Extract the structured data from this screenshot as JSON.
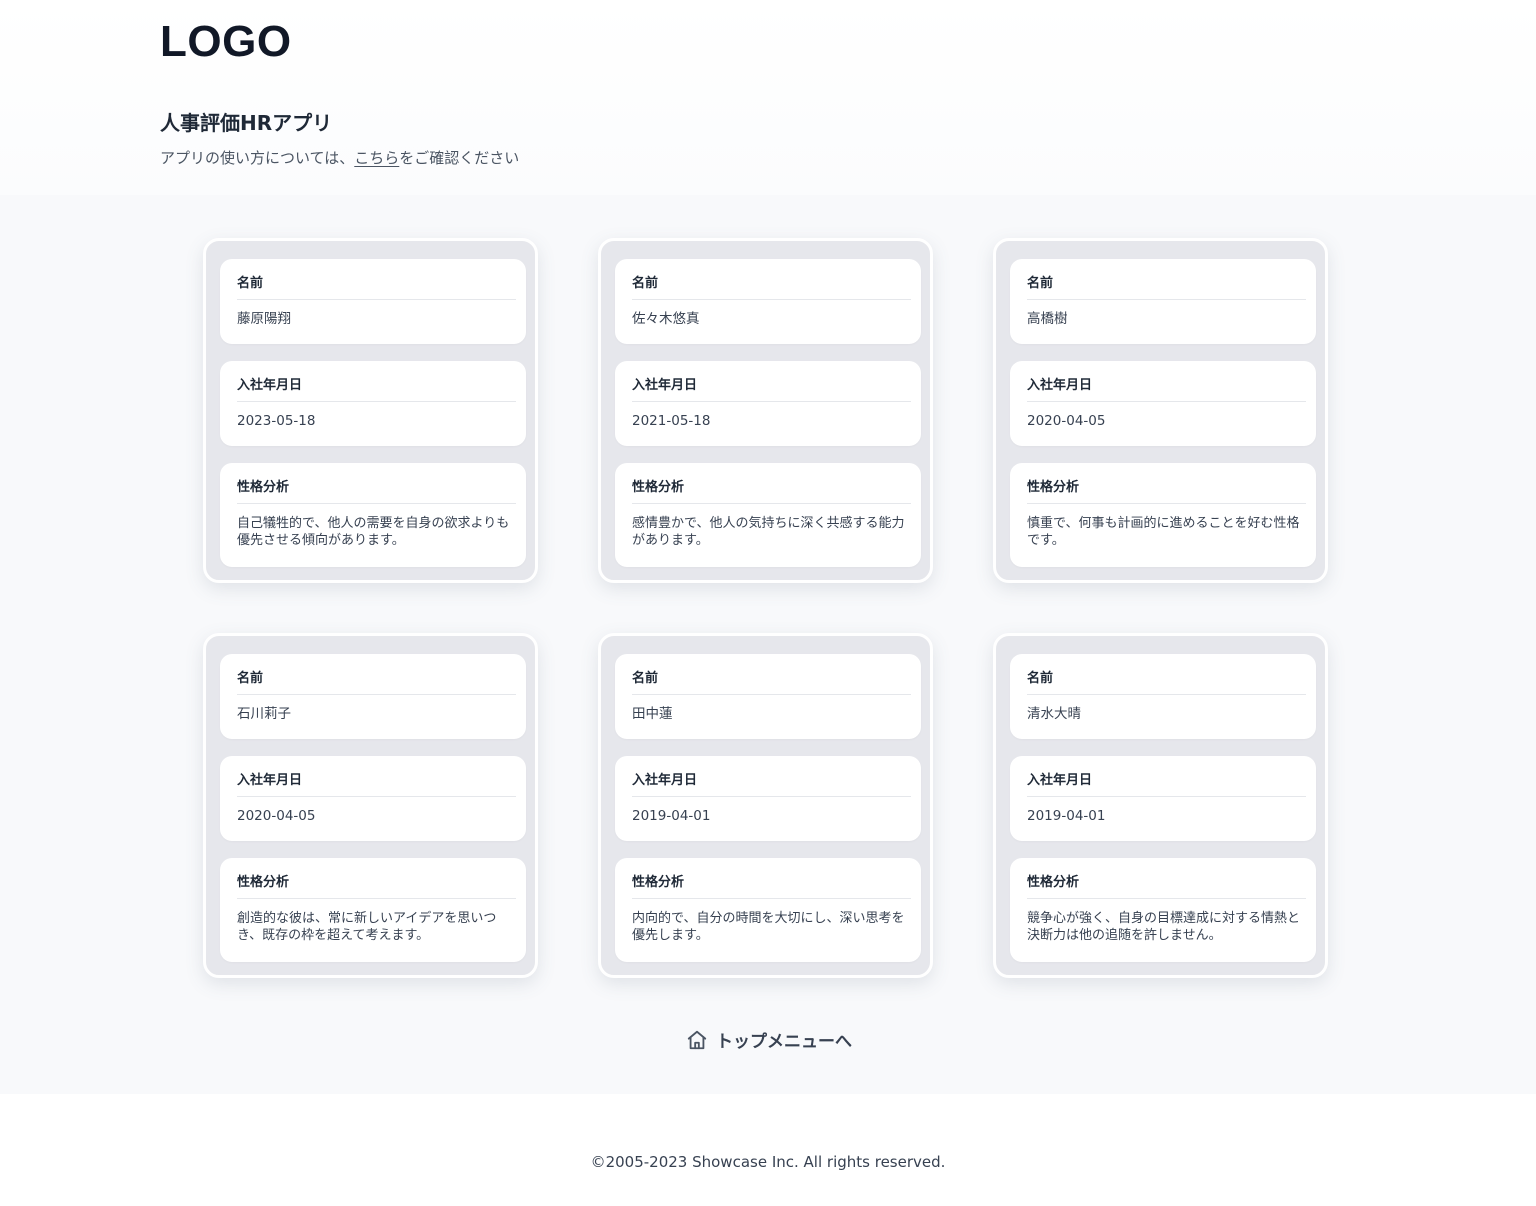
{
  "header": {
    "logo": "LOGO",
    "app_title": "人事評価HRアプリ",
    "subtitle_prefix": "アプリの使い方については、",
    "subtitle_link": "こちら",
    "subtitle_suffix": "をご確認ください"
  },
  "employees": [
    {
      "name_label": "名前",
      "name": "藤原陽翔",
      "date_label": "入社年月日",
      "date": "2023-05-18",
      "analysis_label": "性格分析",
      "analysis": "自己犠牲的で、他人の需要を自身の欲求よりも優先させる傾向があります。"
    },
    {
      "name_label": "名前",
      "name": "佐々木悠真",
      "date_label": "入社年月日",
      "date": "2021-05-18",
      "analysis_label": "性格分析",
      "analysis": "感情豊かで、他人の気持ちに深く共感する能力があります。"
    },
    {
      "name_label": "名前",
      "name": "高橋樹",
      "date_label": "入社年月日",
      "date": "2020-04-05",
      "analysis_label": "性格分析",
      "analysis": "慎重で、何事も計画的に進めることを好む性格です。"
    },
    {
      "name_label": "名前",
      "name": "石川莉子",
      "date_label": "入社年月日",
      "date": "2020-04-05",
      "analysis_label": "性格分析",
      "analysis": "創造的な彼は、常に新しいアイデアを思いつき、既存の枠を超えて考えます。"
    },
    {
      "name_label": "名前",
      "name": "田中蓮",
      "date_label": "入社年月日",
      "date": "2019-04-01",
      "analysis_label": "性格分析",
      "analysis": "内向的で、自分の時間を大切にし、深い思考を優先します。"
    },
    {
      "name_label": "名前",
      "name": "清水大晴",
      "date_label": "入社年月日",
      "date": "2019-04-01",
      "analysis_label": "性格分析",
      "analysis": "競争心が強く、自身の目標達成に対する情熱と決断力は他の追随を許しません。"
    }
  ],
  "nav": {
    "top_menu_label": "トップメニューへ",
    "top_menu_icon": "home-icon"
  },
  "footer": {
    "copyright": "©2005-2023 Showcase Inc. All rights reserved."
  }
}
